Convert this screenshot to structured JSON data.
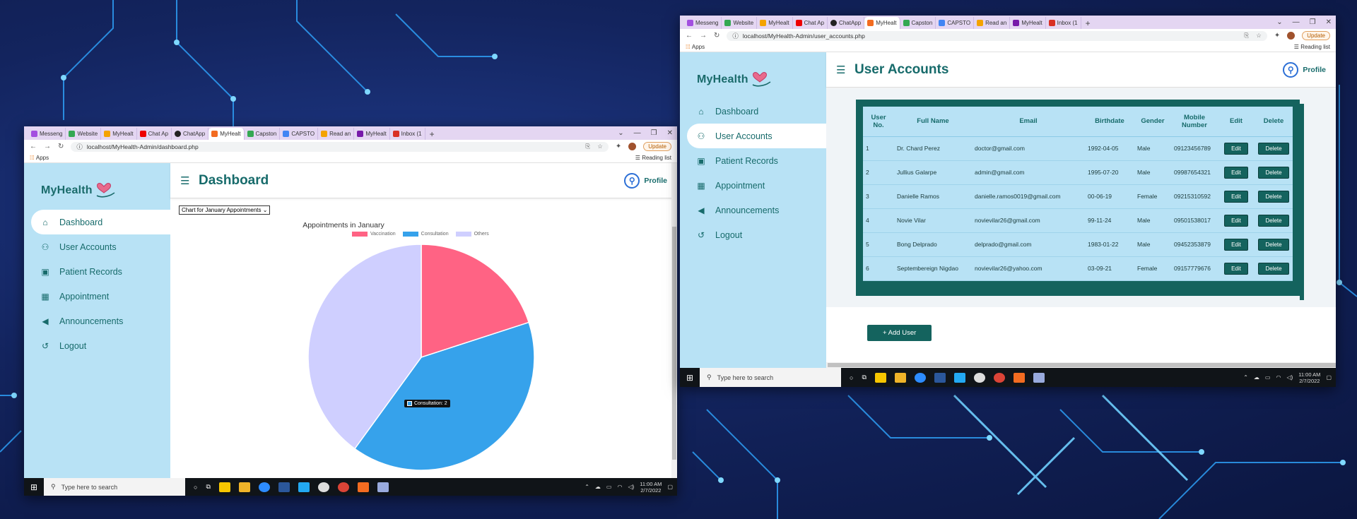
{
  "colors": {
    "teal": "#176b6b",
    "sidebar": "#b8e2f5",
    "button": "#14635e",
    "vaccination": "#ff6384",
    "consultation": "#36a2eb",
    "others": "#cfcfff"
  },
  "tabs": [
    "Messeng",
    "Website",
    "MyHealt",
    "Chat Ap",
    "ChatApp",
    "MyHealt",
    "Capston",
    "CAPSTO",
    "Read an",
    "MyHealt",
    "Inbox (1"
  ],
  "brand": "MyHealth",
  "nav": {
    "dashboard": "Dashboard",
    "users": "User Accounts",
    "patients": "Patient Records",
    "appointment": "Appointment",
    "announcements": "Announcements",
    "logout": "Logout"
  },
  "profile": "Profile",
  "bookmarks": {
    "apps": "Apps",
    "reading_list": "Reading list"
  },
  "update": "Update",
  "taskbar": {
    "search_placeholder": "Type here to search",
    "time": "11:00 AM",
    "date": "2/7/2022"
  },
  "dashboard": {
    "url": "localhost/MyHealth-Admin/dashboard.php",
    "title": "Dashboard",
    "chart_select": "Chart for January Appointments",
    "tooltip": "Consultation: 2"
  },
  "chart_data": {
    "type": "pie",
    "title": "Appointments in January",
    "categories": [
      "Vaccination",
      "Consultation",
      "Others"
    ],
    "values": [
      1,
      2,
      2
    ],
    "legend": "top",
    "colors": [
      "#ff6384",
      "#36a2eb",
      "#cfcfff"
    ]
  },
  "users": {
    "url": "localhost/MyHealth-Admin/user_accounts.php",
    "title": "User Accounts",
    "headers": {
      "no": "User No.",
      "name": "Full Name",
      "email": "Email",
      "birth": "Birthdate",
      "gender": "Gender",
      "mobile": "Mobile Number",
      "edit": "Edit",
      "delete": "Delete"
    },
    "edit_label": "Edit",
    "delete_label": "Delete",
    "add_label": "+ Add User",
    "rows": [
      {
        "no": "1",
        "name": "Dr. Chard Perez",
        "email": "doctor@gmail.com",
        "birth": "1992-04-05",
        "gender": "Male",
        "mobile": "09123456789"
      },
      {
        "no": "2",
        "name": "Jullius Galarpe",
        "email": "admin@gmail.com",
        "birth": "1995-07-20",
        "gender": "Male",
        "mobile": "09987654321"
      },
      {
        "no": "3",
        "name": "Danielle Ramos",
        "email": "danielle.ramos0019@gmail.com",
        "birth": "00-06-19",
        "gender": "Female",
        "mobile": "09215310592"
      },
      {
        "no": "4",
        "name": "Novie Vilar",
        "email": "novievilar26@gmail.com",
        "birth": "99-11-24",
        "gender": "Male",
        "mobile": "09501538017"
      },
      {
        "no": "5",
        "name": "Bong Delprado",
        "email": "delprado@gmail.com",
        "birth": "1983-01-22",
        "gender": "Male",
        "mobile": "09452353879"
      },
      {
        "no": "6",
        "name": "Septembereign Nigdao",
        "email": "novievilar26@yahoo.com",
        "birth": "03-09-21",
        "gender": "Female",
        "mobile": "09157779676"
      }
    ]
  }
}
